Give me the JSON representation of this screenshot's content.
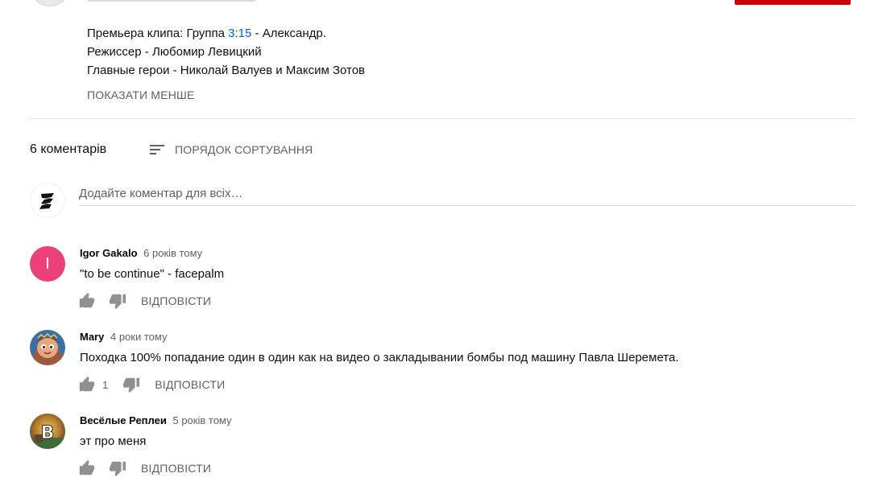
{
  "description": {
    "line1_prefix": "Премьера клипа: Группа ",
    "line1_time": "3:15",
    "line1_suffix": " - Александр.",
    "line2": "Режиссер - Любомир Левицкий",
    "line3": "Главные герои - Николай Валуев и Максим Зотов",
    "show_less": "ПОКАЗАТИ МЕНШЕ"
  },
  "comments_header": {
    "count_label": "6 коментарів",
    "sort_label": "ПОРЯДОК СОРТУВАННЯ"
  },
  "add_comment": {
    "placeholder": "Додайте коментар для всіх…"
  },
  "comments": [
    {
      "author": "Igor Gakalo",
      "time": "6 років тому",
      "text": "\"to be continue\" - facepalm",
      "avatar_letter": "I",
      "avatar_color": "#ec407a",
      "likes": "",
      "reply": "ВІДПОВІСТИ"
    },
    {
      "author": "Mary",
      "time": "4 роки тому",
      "text": "Походка 100% попадание один в один как  на видео о закладывании бомбы под машину Павла Шеремета.",
      "likes": "1",
      "reply": "ВІДПОВІСТИ"
    },
    {
      "author": "Весёлые Реплеи",
      "time": "5 років тому",
      "text": "эт про меня",
      "avatar_letter": "B",
      "likes": "",
      "reply": "ВІДПОВІСТИ"
    }
  ],
  "colors": {
    "link_blue": "#065fd4",
    "secondary_text": "#606060",
    "subscribe_red": "#cc0000"
  },
  "icons": [
    "sort-icon",
    "thumb-up-icon",
    "thumb-down-icon"
  ]
}
